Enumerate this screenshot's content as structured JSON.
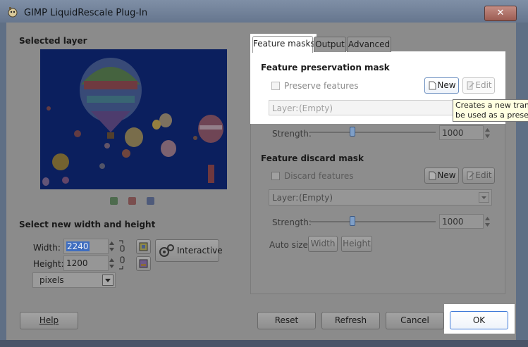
{
  "window": {
    "title": "GIMP LiquidRescale Plug-In",
    "close_label": "✕"
  },
  "left": {
    "selected_layer_heading": "Selected layer",
    "resize_heading": "Select new width and height",
    "width_label": "Width:",
    "width_value": "2240",
    "height_label": "Height:",
    "height_value": "1200",
    "unit_value": "pixels",
    "interactive_label": "Interactive"
  },
  "tabs": [
    {
      "label": "Feature masks",
      "active": true
    },
    {
      "label": "Output",
      "active": false
    },
    {
      "label": "Advanced",
      "active": false
    }
  ],
  "preservation": {
    "heading": "Feature preservation mask",
    "checkbox_label": "Preserve features",
    "new_label": "New",
    "edit_label": "Edit",
    "layer_label": "Layer:",
    "layer_value": "(Empty)",
    "strength_label": "Strength:",
    "strength_value": "1000"
  },
  "discard": {
    "heading": "Feature discard mask",
    "checkbox_label": "Discard features",
    "new_label": "New",
    "edit_label": "Edit",
    "layer_label": "Layer:",
    "layer_value": "(Empty)",
    "strength_label": "Strength:",
    "strength_value": "1000"
  },
  "autosize": {
    "label": "Auto size:",
    "width_label": "Width",
    "height_label": "Height"
  },
  "tooltip": {
    "line1": "Creates a new transp",
    "line2": "be used as a preserv"
  },
  "footer": {
    "help_label": "Help",
    "reset_label": "Reset",
    "refresh_label": "Refresh",
    "cancel_label": "Cancel",
    "ok_label": "OK"
  },
  "colors": {
    "accent_blue": "#3f6ec0",
    "dim_overlay": "#8b8b8b",
    "highlight": "#ffffff",
    "tooltip_bg": "#ffffe1"
  }
}
